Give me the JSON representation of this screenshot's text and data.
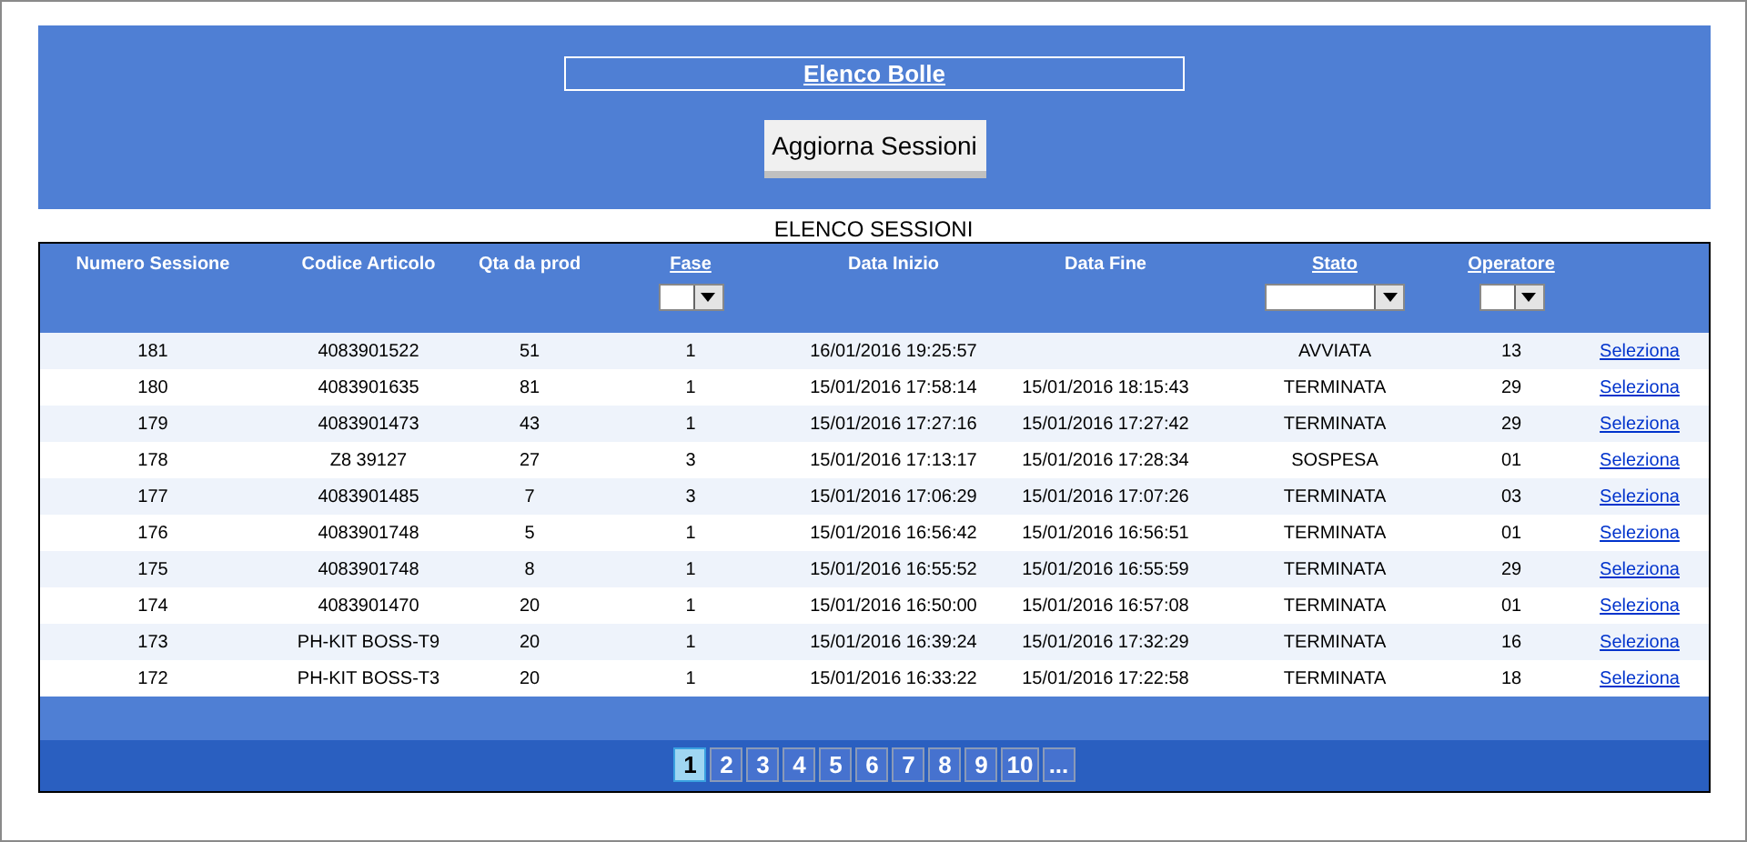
{
  "header": {
    "title": "Elenco Bolle",
    "button": "Aggiorna Sessioni"
  },
  "caption": "ELENCO SESSIONI",
  "columns": [
    {
      "label": "Numero Sessione",
      "sortable": false
    },
    {
      "label": "Codice Articolo",
      "sortable": false
    },
    {
      "label": "Qta da prod",
      "sortable": false
    },
    {
      "label": "Fase",
      "sortable": true,
      "filter": true
    },
    {
      "label": "Data Inizio",
      "sortable": false
    },
    {
      "label": "Data Fine",
      "sortable": false
    },
    {
      "label": "Stato",
      "sortable": true,
      "filter": true
    },
    {
      "label": "Operatore",
      "sortable": true,
      "filter": true
    }
  ],
  "rows": [
    {
      "cells": [
        "181",
        "4083901522",
        "51",
        "1",
        "16/01/2016 19:25:57",
        "",
        "AVVIATA",
        "13"
      ],
      "link": "Seleziona"
    },
    {
      "cells": [
        "180",
        "4083901635",
        "81",
        "1",
        "15/01/2016 17:58:14",
        "15/01/2016 18:15:43",
        "TERMINATA",
        "29"
      ],
      "link": "Seleziona"
    },
    {
      "cells": [
        "179",
        "4083901473",
        "43",
        "1",
        "15/01/2016 17:27:16",
        "15/01/2016 17:27:42",
        "TERMINATA",
        "29"
      ],
      "link": "Seleziona"
    },
    {
      "cells": [
        "178",
        "Z8 39127",
        "27",
        "3",
        "15/01/2016 17:13:17",
        "15/01/2016 17:28:34",
        "SOSPESA",
        "01"
      ],
      "link": "Seleziona"
    },
    {
      "cells": [
        "177",
        "4083901485",
        "7",
        "3",
        "15/01/2016 17:06:29",
        "15/01/2016 17:07:26",
        "TERMINATA",
        "03"
      ],
      "link": "Seleziona"
    },
    {
      "cells": [
        "176",
        "4083901748",
        "5",
        "1",
        "15/01/2016 16:56:42",
        "15/01/2016 16:56:51",
        "TERMINATA",
        "01"
      ],
      "link": "Seleziona"
    },
    {
      "cells": [
        "175",
        "4083901748",
        "8",
        "1",
        "15/01/2016 16:55:52",
        "15/01/2016 16:55:59",
        "TERMINATA",
        "29"
      ],
      "link": "Seleziona"
    },
    {
      "cells": [
        "174",
        "4083901470",
        "20",
        "1",
        "15/01/2016 16:50:00",
        "15/01/2016 16:57:08",
        "TERMINATA",
        "01"
      ],
      "link": "Seleziona"
    },
    {
      "cells": [
        "173",
        "PH-KIT BOSS-T9",
        "20",
        "1",
        "15/01/2016 16:39:24",
        "15/01/2016 17:32:29",
        "TERMINATA",
        "16"
      ],
      "link": "Seleziona"
    },
    {
      "cells": [
        "172",
        "PH-KIT BOSS-T3",
        "20",
        "1",
        "15/01/2016 16:33:22",
        "15/01/2016 17:22:58",
        "TERMINATA",
        "18"
      ],
      "link": "Seleziona"
    }
  ],
  "pages": [
    {
      "label": "1",
      "selected": true
    },
    {
      "label": "2",
      "selected": false
    },
    {
      "label": "3",
      "selected": false
    },
    {
      "label": "4",
      "selected": false
    },
    {
      "label": "5",
      "selected": false
    },
    {
      "label": "6",
      "selected": false
    },
    {
      "label": "7",
      "selected": false
    },
    {
      "label": "8",
      "selected": false
    },
    {
      "label": "9",
      "selected": false
    },
    {
      "label": "10",
      "selected": false
    },
    {
      "label": "...",
      "selected": false
    }
  ]
}
